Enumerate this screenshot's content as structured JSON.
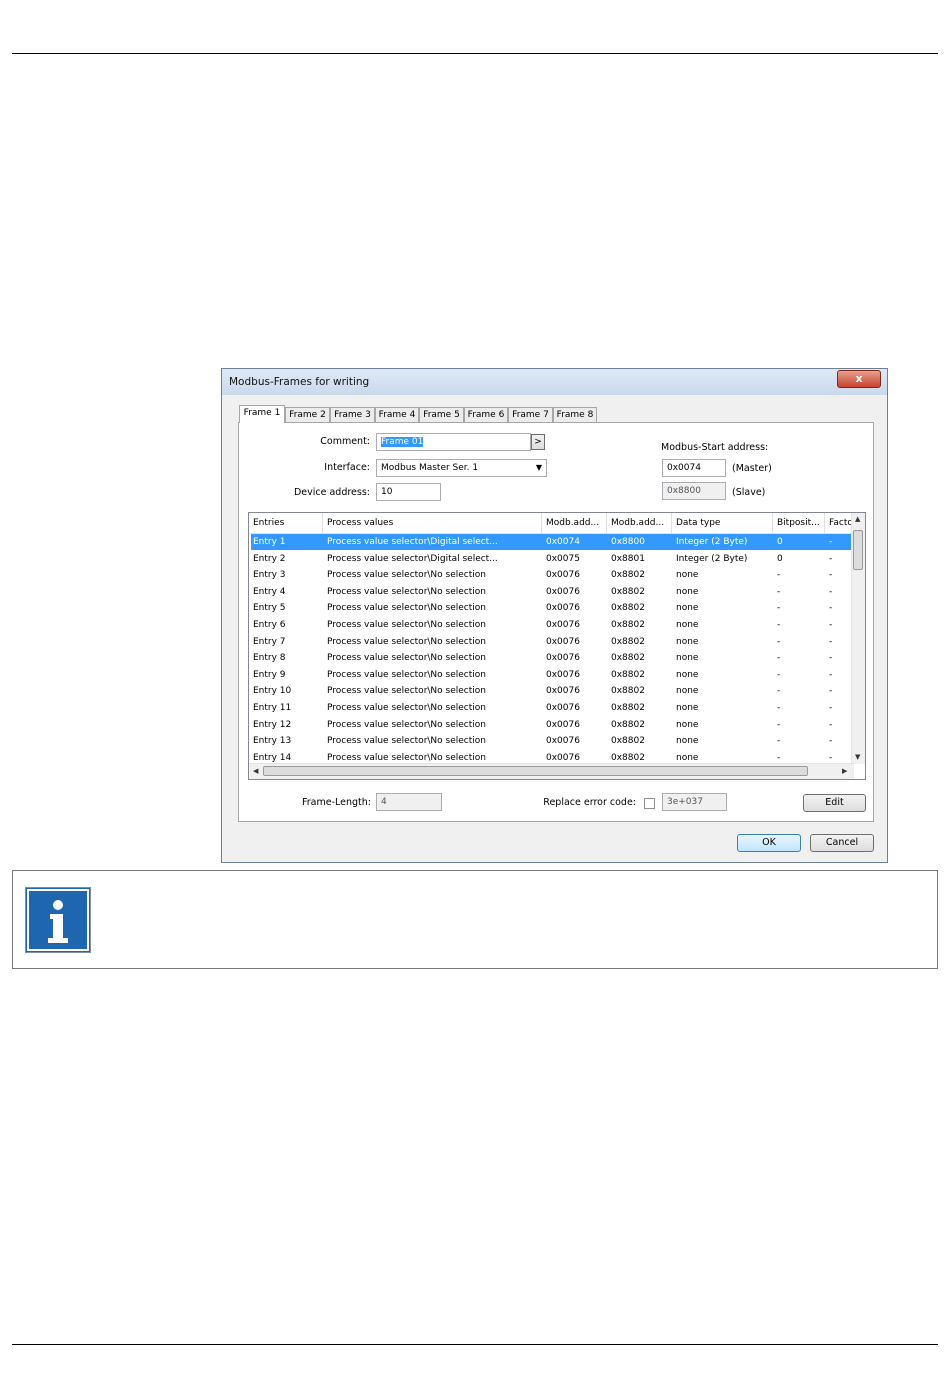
{
  "dialog": {
    "title": "Modbus-Frames for writing",
    "close_glyph": "x",
    "tabs": [
      "Frame 1",
      "Frame 2",
      "Frame 3",
      "Frame 4",
      "Frame 5",
      "Frame 6",
      "Frame 7",
      "Frame 8"
    ],
    "active_tab": "Frame 1",
    "comment_label": "Comment:",
    "comment_value": "Frame 01",
    "comment_button": ">",
    "interface_label": "Interface:",
    "interface_value": "Modbus Master Ser. 1",
    "device_address_label": "Device address:",
    "device_address_value": "10",
    "start_address_label": "Modbus-Start address:",
    "master_address": "0x0074",
    "master_label": "(Master)",
    "slave_address": "0x8800",
    "slave_label": "(Slave)",
    "columns": [
      "Entries",
      "Process values",
      "Modb.add...",
      "Modb.add...",
      "Data type",
      "Bitposit...",
      "Facto"
    ],
    "rows": [
      [
        "Entry 1",
        "Process value selector\\Digital select...",
        "0x0074",
        "0x8800",
        "Integer (2 Byte)",
        "0",
        "-"
      ],
      [
        "Entry 2",
        "Process value selector\\Digital select...",
        "0x0075",
        "0x8801",
        "Integer (2 Byte)",
        "0",
        "-"
      ],
      [
        "Entry 3",
        "Process value selector\\No selection",
        "0x0076",
        "0x8802",
        "none",
        "-",
        "-"
      ],
      [
        "Entry 4",
        "Process value selector\\No selection",
        "0x0076",
        "0x8802",
        "none",
        "-",
        "-"
      ],
      [
        "Entry 5",
        "Process value selector\\No selection",
        "0x0076",
        "0x8802",
        "none",
        "-",
        "-"
      ],
      [
        "Entry 6",
        "Process value selector\\No selection",
        "0x0076",
        "0x8802",
        "none",
        "-",
        "-"
      ],
      [
        "Entry 7",
        "Process value selector\\No selection",
        "0x0076",
        "0x8802",
        "none",
        "-",
        "-"
      ],
      [
        "Entry 8",
        "Process value selector\\No selection",
        "0x0076",
        "0x8802",
        "none",
        "-",
        "-"
      ],
      [
        "Entry 9",
        "Process value selector\\No selection",
        "0x0076",
        "0x8802",
        "none",
        "-",
        "-"
      ],
      [
        "Entry 10",
        "Process value selector\\No selection",
        "0x0076",
        "0x8802",
        "none",
        "-",
        "-"
      ],
      [
        "Entry 11",
        "Process value selector\\No selection",
        "0x0076",
        "0x8802",
        "none",
        "-",
        "-"
      ],
      [
        "Entry 12",
        "Process value selector\\No selection",
        "0x0076",
        "0x8802",
        "none",
        "-",
        "-"
      ],
      [
        "Entry 13",
        "Process value selector\\No selection",
        "0x0076",
        "0x8802",
        "none",
        "-",
        "-"
      ],
      [
        "Entry 14",
        "Process value selector\\No selection",
        "0x0076",
        "0x8802",
        "none",
        "-",
        "-"
      ]
    ],
    "selected_row": 0,
    "frame_length_label": "Frame-Length:",
    "frame_length_value": "4",
    "replace_error_label": "Replace error code:",
    "replace_error_checked": false,
    "replace_error_value": "3e+037",
    "edit_button": "Edit",
    "ok_button": "OK",
    "cancel_button": "Cancel"
  },
  "note": {
    "icon": "info-icon",
    "icon_glyph": "i",
    "icon_color": "#1f66b0"
  }
}
